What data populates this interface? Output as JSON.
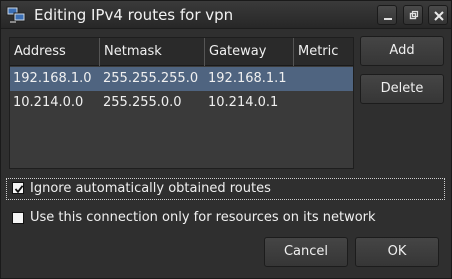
{
  "window": {
    "title": "Editing IPv4 routes for  vpn",
    "controls": [
      "minimize",
      "maximize",
      "close"
    ]
  },
  "routes_table": {
    "columns": [
      "Address",
      "Netmask",
      "Gateway",
      "Metric"
    ],
    "rows": [
      {
        "address": "192.168.1.0",
        "netmask": "255.255.255.0",
        "gateway": "192.168.1.1",
        "metric": "",
        "selected": true
      },
      {
        "address": "10.214.0.0",
        "netmask": "255.255.0.0",
        "gateway": "10.214.0.1",
        "metric": "",
        "selected": false
      }
    ]
  },
  "buttons": {
    "add": "Add",
    "delete": "Delete",
    "cancel": "Cancel",
    "ok": "OK"
  },
  "options": {
    "ignore_auto_routes": {
      "label": "Ignore automatically obtained routes",
      "checked": true
    },
    "only_network_resources": {
      "label": "Use this connection only for resources on its network",
      "checked": false
    }
  },
  "colors": {
    "background": "#2f2f2f",
    "selection": "#4f6480"
  },
  "icons": {
    "app": "network-connection-icon",
    "minimize": "minimize-icon",
    "maximize": "maximize-icon",
    "close": "close-icon",
    "check": "checkmark-icon"
  }
}
